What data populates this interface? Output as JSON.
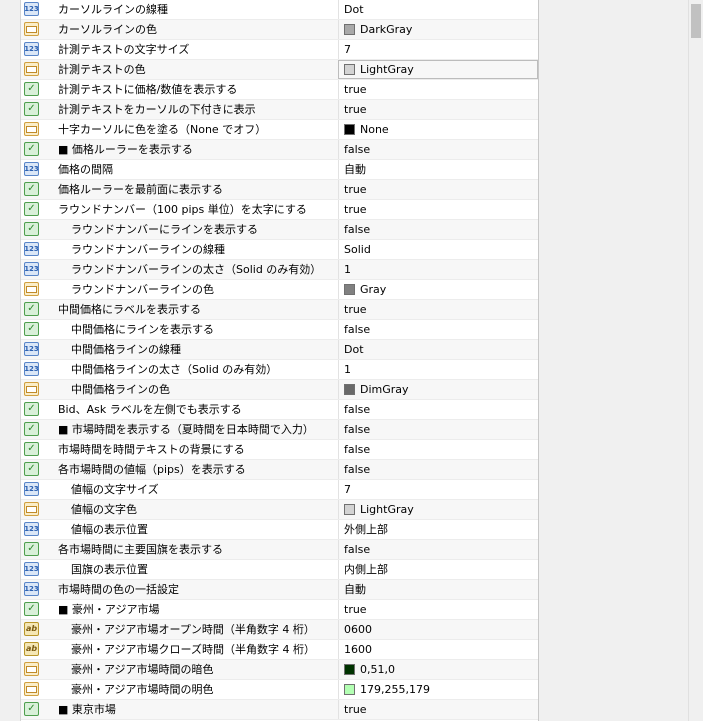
{
  "rows": [
    {
      "icon": "num",
      "label": "カーソルラインの線種",
      "value": "Dot",
      "indent": 0
    },
    {
      "icon": "col",
      "label": "カーソルラインの色",
      "value": "DarkGray",
      "swatch": "#a9a9a9",
      "indent": 0
    },
    {
      "icon": "num",
      "label": "計測テキストの文字サイズ",
      "value": "7",
      "indent": 0
    },
    {
      "icon": "col",
      "label": "計測テキストの色",
      "value": "LightGray",
      "swatch": "#d3d3d3",
      "indent": 0,
      "editable": true
    },
    {
      "icon": "chk",
      "label": "計測テキストに価格/数値を表示する",
      "value": "true",
      "indent": 0
    },
    {
      "icon": "chk",
      "label": "計測テキストをカーソルの下付きに表示",
      "value": "true",
      "indent": 0
    },
    {
      "icon": "col",
      "label": "十字カーソルに色を塗る（None でオフ）",
      "value": "None",
      "swatch": "#000000",
      "indent": 0
    },
    {
      "icon": "chk",
      "label": "■ 価格ルーラーを表示する",
      "value": "false",
      "indent": 0,
      "bullet": true
    },
    {
      "icon": "num",
      "label": "価格の間隔",
      "value": "自動",
      "indent": 0
    },
    {
      "icon": "chk",
      "label": "価格ルーラーを最前面に表示する",
      "value": "true",
      "indent": 0
    },
    {
      "icon": "chk",
      "label": "ラウンドナンバー（100 pips 単位）を太字にする",
      "value": "true",
      "indent": 0
    },
    {
      "icon": "chk",
      "label": "ラウンドナンバーにラインを表示する",
      "value": "false",
      "indent": 1
    },
    {
      "icon": "num",
      "label": "ラウンドナンバーラインの線種",
      "value": "Solid",
      "indent": 1
    },
    {
      "icon": "num",
      "label": "ラウンドナンバーラインの太さ（Solid のみ有効）",
      "value": "1",
      "indent": 1
    },
    {
      "icon": "col",
      "label": "ラウンドナンバーラインの色",
      "value": "Gray",
      "swatch": "#808080",
      "indent": 1
    },
    {
      "icon": "chk",
      "label": "中間価格にラベルを表示する",
      "value": "true",
      "indent": 0
    },
    {
      "icon": "chk",
      "label": "中間価格にラインを表示する",
      "value": "false",
      "indent": 1
    },
    {
      "icon": "num",
      "label": "中間価格ラインの線種",
      "value": "Dot",
      "indent": 1
    },
    {
      "icon": "num",
      "label": "中間価格ラインの太さ（Solid のみ有効）",
      "value": "1",
      "indent": 1
    },
    {
      "icon": "col",
      "label": "中間価格ラインの色",
      "value": "DimGray",
      "swatch": "#696969",
      "indent": 1
    },
    {
      "icon": "chk",
      "label": "Bid、Ask ラベルを左側でも表示する",
      "value": "false",
      "indent": 0
    },
    {
      "icon": "chk",
      "label": "■ 市場時間を表示する（夏時間を日本時間で入力）",
      "value": "false",
      "indent": 0
    },
    {
      "icon": "chk",
      "label": "市場時間を時間テキストの背景にする",
      "value": "false",
      "indent": 0
    },
    {
      "icon": "chk",
      "label": "各市場時間の値幅（pips）を表示する",
      "value": "false",
      "indent": 0
    },
    {
      "icon": "num",
      "label": "値幅の文字サイズ",
      "value": "7",
      "indent": 1
    },
    {
      "icon": "col",
      "label": "値幅の文字色",
      "value": "LightGray",
      "swatch": "#d3d3d3",
      "indent": 1
    },
    {
      "icon": "num",
      "label": "値幅の表示位置",
      "value": "外側上部",
      "indent": 1
    },
    {
      "icon": "chk",
      "label": "各市場時間に主要国旗を表示する",
      "value": "false",
      "indent": 0
    },
    {
      "icon": "num",
      "label": "国旗の表示位置",
      "value": "内側上部",
      "indent": 1
    },
    {
      "icon": "num",
      "label": "市場時間の色の一括設定",
      "value": "自動",
      "indent": 0
    },
    {
      "icon": "chk",
      "label": "■ 豪州・アジア市場",
      "value": "true",
      "indent": 0
    },
    {
      "icon": "txt",
      "label": "豪州・アジア市場オープン時間（半角数字 4 桁）",
      "value": "0600",
      "indent": 1
    },
    {
      "icon": "txt",
      "label": "豪州・アジア市場クローズ時間（半角数字 4 桁）",
      "value": "1600",
      "indent": 1
    },
    {
      "icon": "col",
      "label": "豪州・アジア市場時間の暗色",
      "value": "0,51,0",
      "swatch": "#003300",
      "indent": 1
    },
    {
      "icon": "col",
      "label": "豪州・アジア市場時間の明色",
      "value": "179,255,179",
      "swatch": "#b3ffb3",
      "indent": 1
    },
    {
      "icon": "chk",
      "label": "■ 東京市場",
      "value": "true",
      "indent": 0
    }
  ],
  "icon_glyphs": {
    "num": "123",
    "chk": "✓",
    "txt": "ab"
  }
}
